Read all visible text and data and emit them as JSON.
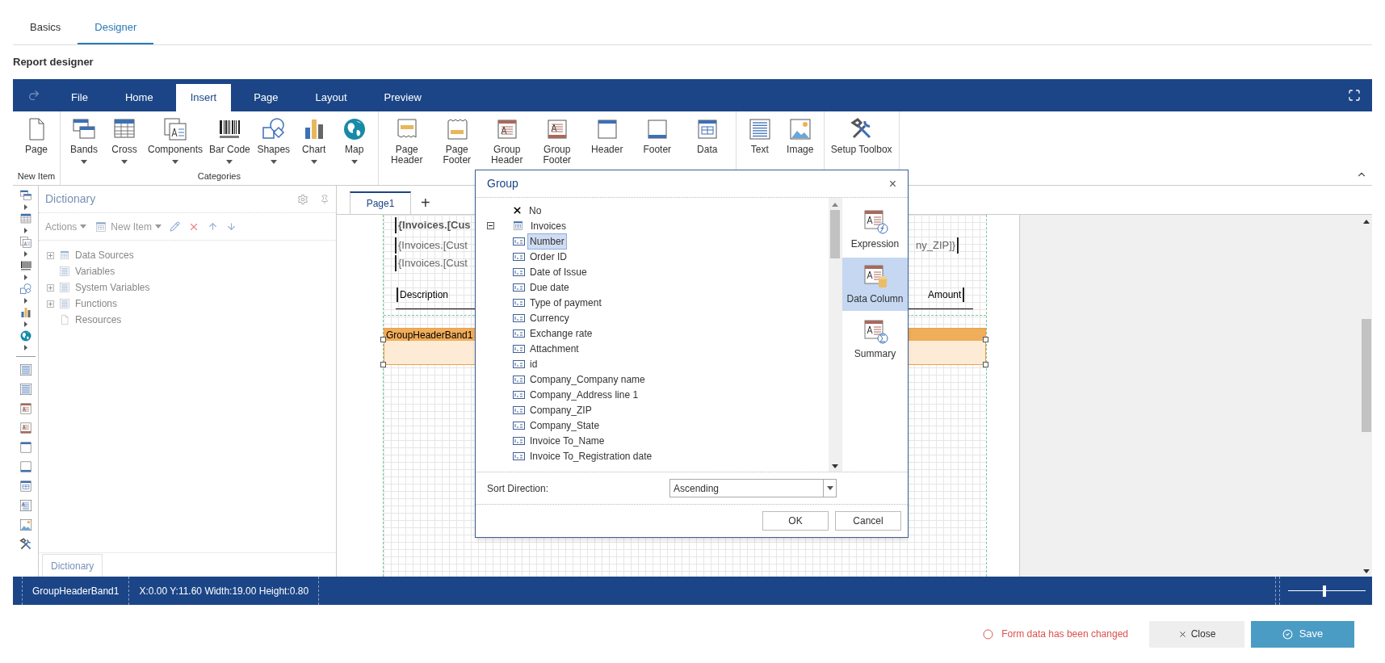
{
  "top_tabs": [
    {
      "label": "Basics",
      "selected": false
    },
    {
      "label": "Designer",
      "selected": true
    }
  ],
  "section_title": "Report designer",
  "menu": {
    "tabs": [
      {
        "label": "File",
        "selected": false
      },
      {
        "label": "Home",
        "selected": false
      },
      {
        "label": "Insert",
        "selected": true
      },
      {
        "label": "Page",
        "selected": false
      },
      {
        "label": "Layout",
        "selected": false
      },
      {
        "label": "Preview",
        "selected": false
      }
    ]
  },
  "ribbon": {
    "groups": [
      {
        "label": "New Item",
        "items": [
          {
            "label": "Page",
            "dropdown": false
          }
        ]
      },
      {
        "label": "Categories",
        "items": [
          {
            "label": "Bands",
            "dropdown": true
          },
          {
            "label": "Cross",
            "dropdown": true
          },
          {
            "label": "Components",
            "dropdown": true
          },
          {
            "label": "Bar Code",
            "dropdown": true
          },
          {
            "label": "Shapes",
            "dropdown": true
          },
          {
            "label": "Chart",
            "dropdown": true
          },
          {
            "label": "Map",
            "dropdown": true
          }
        ]
      },
      {
        "items": [
          {
            "label": "Page Header",
            "dropdown": false
          },
          {
            "label": "Page Footer",
            "dropdown": false
          },
          {
            "label": "Group Header",
            "dropdown": false
          },
          {
            "label": "Group Footer",
            "dropdown": false
          },
          {
            "label": "Header",
            "dropdown": false
          },
          {
            "label": "Footer",
            "dropdown": false
          },
          {
            "label": "Data",
            "dropdown": false
          }
        ]
      },
      {
        "items": [
          {
            "label": "Text",
            "dropdown": false
          },
          {
            "label": "Image",
            "dropdown": false
          }
        ]
      },
      {
        "items": [
          {
            "label": "Setup Toolbox",
            "dropdown": false
          }
        ]
      }
    ]
  },
  "dictionary": {
    "title": "Dictionary",
    "disabled": true,
    "toolbar": [
      {
        "label": "Actions"
      },
      {
        "label": "New Item"
      }
    ],
    "items": [
      {
        "label": "Data Sources",
        "expandable": true
      },
      {
        "label": "Variables",
        "expandable": false
      },
      {
        "label": "System Variables",
        "expandable": true
      },
      {
        "label": "Functions",
        "expandable": true
      },
      {
        "label": "Resources",
        "expandable": false
      }
    ],
    "bottom_tab": "Dictionary"
  },
  "canvas": {
    "tabs": [
      {
        "label": "Page1",
        "selected": true
      }
    ],
    "add_tab": "+",
    "texts": [
      {
        "text": "{Invoices.[Cus",
        "kind": "bold"
      },
      {
        "text": "{Invoices.[Cust",
        "kind": "field"
      },
      {
        "text": "ny_ZIP]}",
        "kind": "field"
      },
      {
        "text": "{Invoices.[Cust",
        "kind": "field"
      },
      {
        "text": "Description",
        "kind": "label"
      },
      {
        "text": "Amount",
        "kind": "label"
      }
    ],
    "band": {
      "label": "GroupHeaderBand1",
      "selected": true
    }
  },
  "dialog": {
    "title": "Group",
    "close": "×",
    "tree": [
      {
        "label": "No",
        "kind": "none",
        "selected": false
      },
      {
        "label": "Invoices",
        "kind": "table",
        "selected": false,
        "expanded": true,
        "children": [
          {
            "label": "Number",
            "selected": true
          },
          {
            "label": "Order ID",
            "selected": false
          },
          {
            "label": "Date of Issue",
            "selected": false
          },
          {
            "label": "Due date",
            "selected": false
          },
          {
            "label": "Type of payment",
            "selected": false
          },
          {
            "label": "Currency",
            "selected": false
          },
          {
            "label": "Exchange rate",
            "selected": false
          },
          {
            "label": "Attachment",
            "selected": false
          },
          {
            "label": "id",
            "selected": false
          },
          {
            "label": "Company_Company name",
            "selected": false
          },
          {
            "label": "Company_Address line 1",
            "selected": false
          },
          {
            "label": "Company_ZIP",
            "selected": false
          },
          {
            "label": "Company_State",
            "selected": false
          },
          {
            "label": "Invoice To_Name",
            "selected": false
          },
          {
            "label": "Invoice To_Registration date",
            "selected": false
          }
        ]
      }
    ],
    "modes": [
      {
        "label": "Expression",
        "selected": false
      },
      {
        "label": "Data Column",
        "selected": true
      },
      {
        "label": "Summary",
        "selected": false
      }
    ],
    "sort_label": "Sort Direction:",
    "sort_value": "Ascending",
    "buttons": [
      "OK",
      "Cancel"
    ]
  },
  "status_bar": {
    "component": "GroupHeaderBand1",
    "position": "X:0.00 Y:11.60 Width:19.00 Height:0.80",
    "zoom": {
      "level": 0.47
    }
  },
  "footer": {
    "message": "Form data has been changed",
    "close": "Close",
    "save": "Save"
  }
}
